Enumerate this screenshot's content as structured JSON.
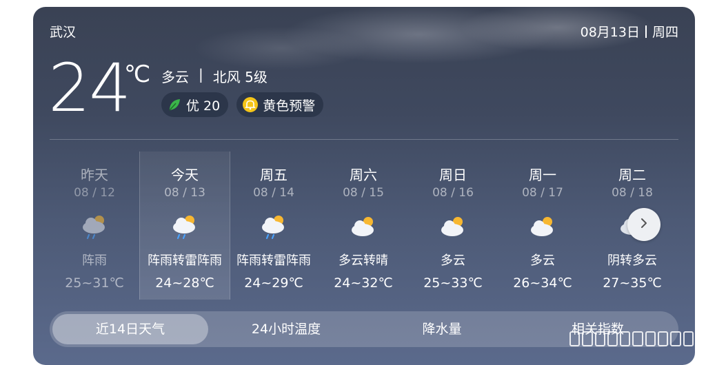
{
  "header": {
    "city": "武汉",
    "date": "08月13日",
    "weekday": "周四"
  },
  "current": {
    "temperature": "24",
    "unit": "℃",
    "condition": "多云",
    "separator": "|",
    "wind": "北风 5级",
    "aqi_label": "优 20",
    "warning_label": "黄色预警"
  },
  "forecast": [
    {
      "name": "昨天",
      "date": "08 / 12",
      "icon": "cloud-rain-sun-icon",
      "desc": "阵雨",
      "temp": "25~31℃",
      "state": "past"
    },
    {
      "name": "今天",
      "date": "08 / 13",
      "icon": "cloud-rain-sun-icon",
      "desc": "阵雨转雷阵雨",
      "temp": "24~28℃",
      "state": "today"
    },
    {
      "name": "周五",
      "date": "08 / 14",
      "icon": "cloud-rain-sun-icon",
      "desc": "阵雨转雷阵雨",
      "temp": "24~29℃",
      "state": "future"
    },
    {
      "name": "周六",
      "date": "08 / 15",
      "icon": "partly-cloudy-icon",
      "desc": "多云转晴",
      "temp": "24~32℃",
      "state": "future"
    },
    {
      "name": "周日",
      "date": "08 / 16",
      "icon": "partly-cloudy-icon",
      "desc": "多云",
      "temp": "25~33℃",
      "state": "future"
    },
    {
      "name": "周一",
      "date": "08 / 17",
      "icon": "partly-cloudy-icon",
      "desc": "多云",
      "temp": "26~34℃",
      "state": "future"
    },
    {
      "name": "周二",
      "date": "08 / 18",
      "icon": "cloudy-icon",
      "desc": "阴转多云",
      "temp": "27~35℃",
      "state": "future"
    }
  ],
  "tabs": [
    {
      "label": "近14日天气",
      "active": true
    },
    {
      "label": "24小时温度",
      "active": false
    },
    {
      "label": "降水量",
      "active": false
    },
    {
      "label": "相关指数",
      "active": false
    }
  ],
  "colors": {
    "leaf": "#3bb54a",
    "warning": "#f5c518",
    "sun": "#f7b731"
  }
}
